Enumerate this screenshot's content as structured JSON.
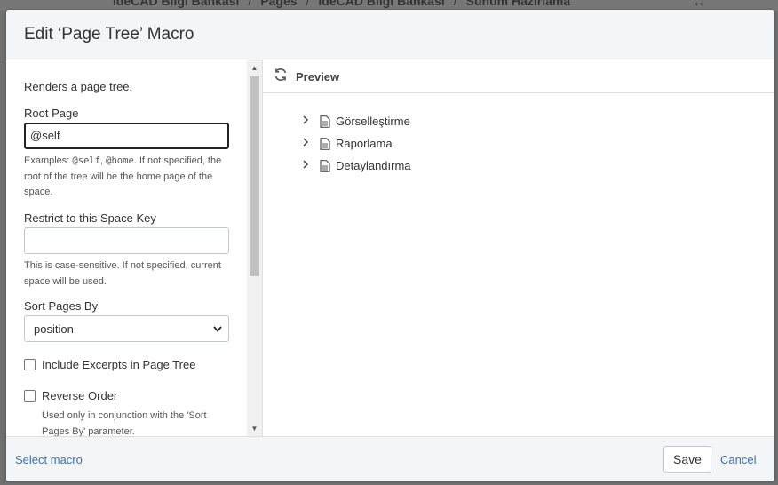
{
  "background": {
    "breadcrumbs": [
      "IdeCAD Bilgi Bankası",
      "Pages",
      "IdeCAD Bilgi Bankası",
      "Sunum Hazırlama"
    ],
    "separator": "/"
  },
  "dialog": {
    "title": "Edit ‘Page Tree’ Macro"
  },
  "form": {
    "description": "Renders a page tree.",
    "root_page": {
      "label": "Root Page",
      "value": "@self",
      "help_prefix": "Examples: ",
      "help_code1": "@self",
      "help_sep": ", ",
      "help_code2": "@home",
      "help_suffix": ". If not specified, the root of the tree will be the home page of the space."
    },
    "space_key": {
      "label": "Restrict to this Space Key",
      "value": "",
      "help": "This is case-sensitive. If not specified, current space will be used."
    },
    "sort": {
      "label": "Sort Pages By",
      "value": "position"
    },
    "include_excerpts": {
      "label": "Include Excerpts in Page Tree",
      "checked": false
    },
    "reverse_order": {
      "label": "Reverse Order",
      "checked": false,
      "help": "Used only in conjunction with the 'Sort Pages By' parameter."
    }
  },
  "preview": {
    "label": "Preview",
    "items": [
      "Görselleştirme",
      "Raporlama",
      "Detaylandırma"
    ]
  },
  "footer": {
    "select_macro": "Select macro",
    "save": "Save",
    "cancel": "Cancel"
  }
}
